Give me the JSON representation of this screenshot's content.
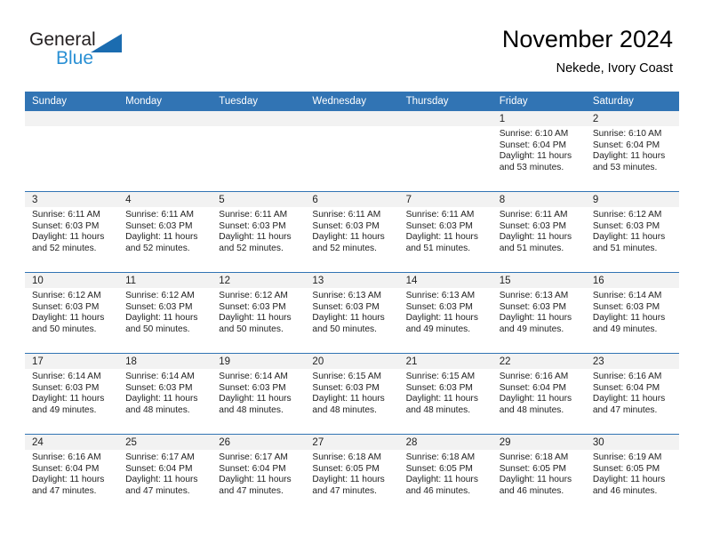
{
  "logo": {
    "word1": "General",
    "word2": "Blue",
    "triangle_color": "#1b6cb0",
    "word2_color": "#2a90d4"
  },
  "header": {
    "title": "November 2024",
    "subtitle": "Nekede, Ivory Coast",
    "accent_color": "#3174B4",
    "daynum_band_color": "#f2f2f2"
  },
  "weekday_headers": [
    "Sunday",
    "Monday",
    "Tuesday",
    "Wednesday",
    "Thursday",
    "Friday",
    "Saturday"
  ],
  "labels": {
    "sunrise": "Sunrise:",
    "sunset": "Sunset:",
    "daylight": "Daylight:"
  },
  "weeks": [
    [
      {
        "day": "",
        "empty": true
      },
      {
        "day": "",
        "empty": true
      },
      {
        "day": "",
        "empty": true
      },
      {
        "day": "",
        "empty": true
      },
      {
        "day": "",
        "empty": true
      },
      {
        "day": "1",
        "sunrise": "Sunrise: 6:10 AM",
        "sunset": "Sunset: 6:04 PM",
        "daylight": "Daylight: 11 hours and 53 minutes."
      },
      {
        "day": "2",
        "sunrise": "Sunrise: 6:10 AM",
        "sunset": "Sunset: 6:04 PM",
        "daylight": "Daylight: 11 hours and 53 minutes."
      }
    ],
    [
      {
        "day": "3",
        "sunrise": "Sunrise: 6:11 AM",
        "sunset": "Sunset: 6:03 PM",
        "daylight": "Daylight: 11 hours and 52 minutes."
      },
      {
        "day": "4",
        "sunrise": "Sunrise: 6:11 AM",
        "sunset": "Sunset: 6:03 PM",
        "daylight": "Daylight: 11 hours and 52 minutes."
      },
      {
        "day": "5",
        "sunrise": "Sunrise: 6:11 AM",
        "sunset": "Sunset: 6:03 PM",
        "daylight": "Daylight: 11 hours and 52 minutes."
      },
      {
        "day": "6",
        "sunrise": "Sunrise: 6:11 AM",
        "sunset": "Sunset: 6:03 PM",
        "daylight": "Daylight: 11 hours and 52 minutes."
      },
      {
        "day": "7",
        "sunrise": "Sunrise: 6:11 AM",
        "sunset": "Sunset: 6:03 PM",
        "daylight": "Daylight: 11 hours and 51 minutes."
      },
      {
        "day": "8",
        "sunrise": "Sunrise: 6:11 AM",
        "sunset": "Sunset: 6:03 PM",
        "daylight": "Daylight: 11 hours and 51 minutes."
      },
      {
        "day": "9",
        "sunrise": "Sunrise: 6:12 AM",
        "sunset": "Sunset: 6:03 PM",
        "daylight": "Daylight: 11 hours and 51 minutes."
      }
    ],
    [
      {
        "day": "10",
        "sunrise": "Sunrise: 6:12 AM",
        "sunset": "Sunset: 6:03 PM",
        "daylight": "Daylight: 11 hours and 50 minutes."
      },
      {
        "day": "11",
        "sunrise": "Sunrise: 6:12 AM",
        "sunset": "Sunset: 6:03 PM",
        "daylight": "Daylight: 11 hours and 50 minutes."
      },
      {
        "day": "12",
        "sunrise": "Sunrise: 6:12 AM",
        "sunset": "Sunset: 6:03 PM",
        "daylight": "Daylight: 11 hours and 50 minutes."
      },
      {
        "day": "13",
        "sunrise": "Sunrise: 6:13 AM",
        "sunset": "Sunset: 6:03 PM",
        "daylight": "Daylight: 11 hours and 50 minutes."
      },
      {
        "day": "14",
        "sunrise": "Sunrise: 6:13 AM",
        "sunset": "Sunset: 6:03 PM",
        "daylight": "Daylight: 11 hours and 49 minutes."
      },
      {
        "day": "15",
        "sunrise": "Sunrise: 6:13 AM",
        "sunset": "Sunset: 6:03 PM",
        "daylight": "Daylight: 11 hours and 49 minutes."
      },
      {
        "day": "16",
        "sunrise": "Sunrise: 6:14 AM",
        "sunset": "Sunset: 6:03 PM",
        "daylight": "Daylight: 11 hours and 49 minutes."
      }
    ],
    [
      {
        "day": "17",
        "sunrise": "Sunrise: 6:14 AM",
        "sunset": "Sunset: 6:03 PM",
        "daylight": "Daylight: 11 hours and 49 minutes."
      },
      {
        "day": "18",
        "sunrise": "Sunrise: 6:14 AM",
        "sunset": "Sunset: 6:03 PM",
        "daylight": "Daylight: 11 hours and 48 minutes."
      },
      {
        "day": "19",
        "sunrise": "Sunrise: 6:14 AM",
        "sunset": "Sunset: 6:03 PM",
        "daylight": "Daylight: 11 hours and 48 minutes."
      },
      {
        "day": "20",
        "sunrise": "Sunrise: 6:15 AM",
        "sunset": "Sunset: 6:03 PM",
        "daylight": "Daylight: 11 hours and 48 minutes."
      },
      {
        "day": "21",
        "sunrise": "Sunrise: 6:15 AM",
        "sunset": "Sunset: 6:03 PM",
        "daylight": "Daylight: 11 hours and 48 minutes."
      },
      {
        "day": "22",
        "sunrise": "Sunrise: 6:16 AM",
        "sunset": "Sunset: 6:04 PM",
        "daylight": "Daylight: 11 hours and 48 minutes."
      },
      {
        "day": "23",
        "sunrise": "Sunrise: 6:16 AM",
        "sunset": "Sunset: 6:04 PM",
        "daylight": "Daylight: 11 hours and 47 minutes."
      }
    ],
    [
      {
        "day": "24",
        "sunrise": "Sunrise: 6:16 AM",
        "sunset": "Sunset: 6:04 PM",
        "daylight": "Daylight: 11 hours and 47 minutes."
      },
      {
        "day": "25",
        "sunrise": "Sunrise: 6:17 AM",
        "sunset": "Sunset: 6:04 PM",
        "daylight": "Daylight: 11 hours and 47 minutes."
      },
      {
        "day": "26",
        "sunrise": "Sunrise: 6:17 AM",
        "sunset": "Sunset: 6:04 PM",
        "daylight": "Daylight: 11 hours and 47 minutes."
      },
      {
        "day": "27",
        "sunrise": "Sunrise: 6:18 AM",
        "sunset": "Sunset: 6:05 PM",
        "daylight": "Daylight: 11 hours and 47 minutes."
      },
      {
        "day": "28",
        "sunrise": "Sunrise: 6:18 AM",
        "sunset": "Sunset: 6:05 PM",
        "daylight": "Daylight: 11 hours and 46 minutes."
      },
      {
        "day": "29",
        "sunrise": "Sunrise: 6:18 AM",
        "sunset": "Sunset: 6:05 PM",
        "daylight": "Daylight: 11 hours and 46 minutes."
      },
      {
        "day": "30",
        "sunrise": "Sunrise: 6:19 AM",
        "sunset": "Sunset: 6:05 PM",
        "daylight": "Daylight: 11 hours and 46 minutes."
      }
    ]
  ]
}
